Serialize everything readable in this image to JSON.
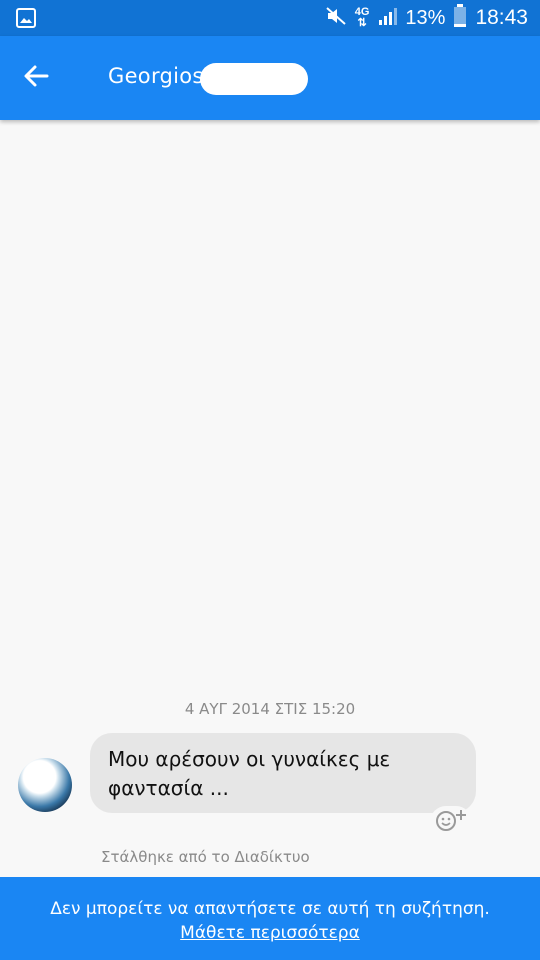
{
  "status_bar": {
    "time": "18:43",
    "battery_percent": "13%",
    "network_type": "4G",
    "icons": [
      "gallery-icon",
      "mute-icon",
      "data-arrows-icon",
      "signal-icon",
      "battery-icon"
    ]
  },
  "header": {
    "contact_name": "Georgios",
    "back_icon": "arrow-left-icon"
  },
  "conversation": {
    "timestamp": "4 ΑΥΓ 2014 ΣΤΙΣ 15:20",
    "messages": [
      {
        "text": "Μου αρέσουν οι γυναίκες με φαντασία ..."
      }
    ],
    "sent_via": "Στάλθηκε από το Διαδίκτυο"
  },
  "footer": {
    "notice": "Δεν μπορείτε να απαντήσετε σε αυτή τη συζήτηση.",
    "learn_more": "Μάθετε περισσότερα"
  },
  "colors": {
    "status_bar": "#1173d4",
    "app_bar": "#1a86f3",
    "bubble": "#e6e6e6",
    "background": "#f8f8f8"
  }
}
